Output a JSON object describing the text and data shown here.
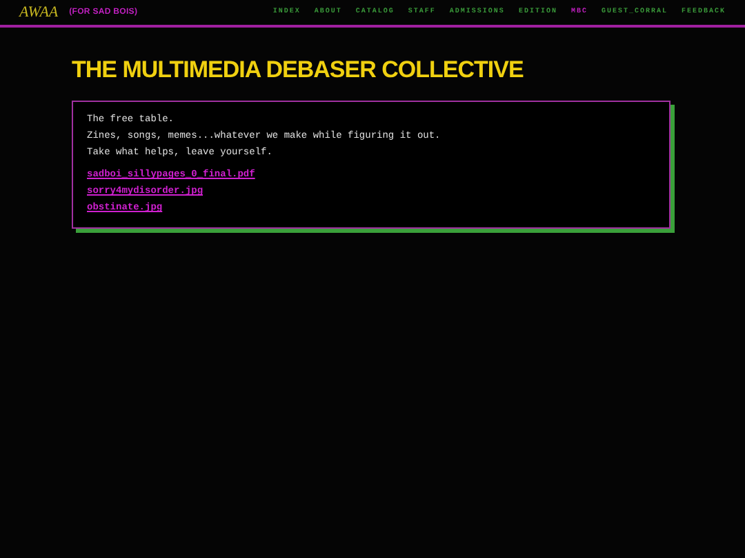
{
  "header": {
    "logo": "AWAA",
    "tagline": "(FOR SAD BOIS)"
  },
  "nav": [
    {
      "label": "INDEX",
      "selected": false
    },
    {
      "label": "ABOUT",
      "selected": false
    },
    {
      "label": "CATALOG",
      "selected": false
    },
    {
      "label": "STAFF",
      "selected": false
    },
    {
      "label": "ADMISSIONS",
      "selected": false
    },
    {
      "label": "EDITION",
      "selected": false
    },
    {
      "label": "MBC",
      "selected": true
    },
    {
      "label": "GUEST_CORRAL",
      "selected": false
    },
    {
      "label": "FEEDBACK",
      "selected": false
    }
  ],
  "title": "THE MULTIMEDIA DEBASER COLLECTIVE",
  "card": {
    "lines": [
      "The free table.",
      "Zines, songs, memes...whatever we make while figuring it out.",
      "Take what helps, leave yourself."
    ],
    "links": [
      "sadboi_sillypages_0_final.pdf",
      "sorry4mydisorder.jpg",
      "obstinate.jpg"
    ]
  }
}
